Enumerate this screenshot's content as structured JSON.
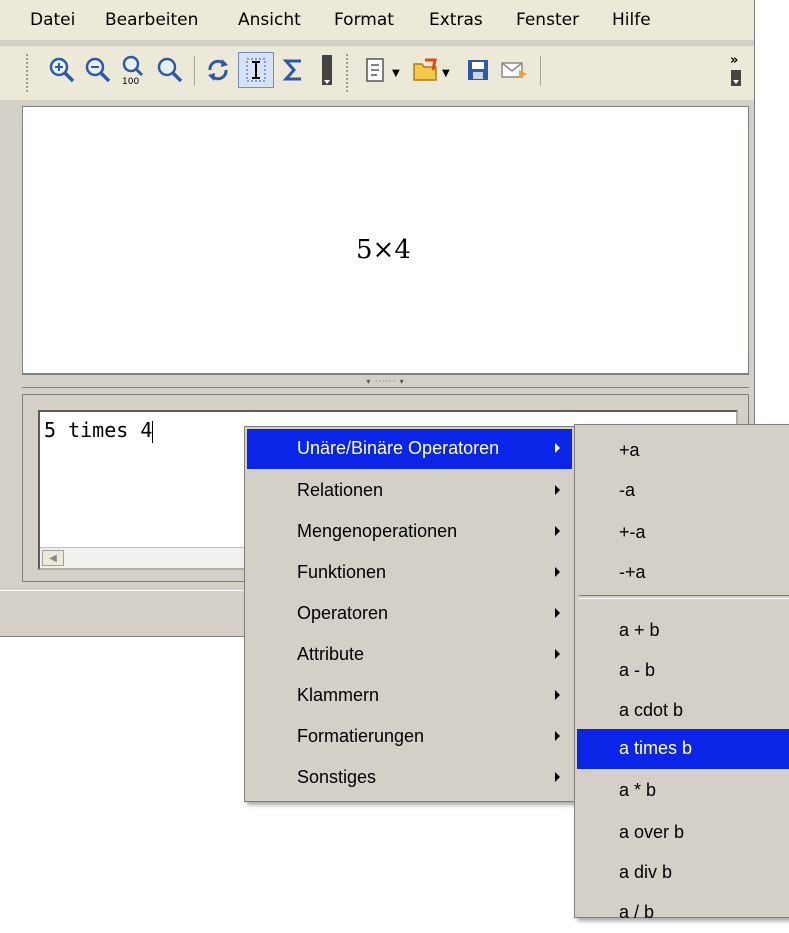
{
  "menubar": {
    "items": [
      "Datei",
      "Bearbeiten",
      "Ansicht",
      "Format",
      "Extras",
      "Fenster",
      "Hilfe"
    ]
  },
  "toolbar": {
    "buttons": [
      "zoom-in-icon",
      "zoom-out-icon",
      "zoom-100-icon",
      "show-all-icon",
      "refresh-icon",
      "formula-cursor-icon",
      "sum-icon",
      "more-icon",
      "import-icon",
      "open-icon",
      "save-icon",
      "send-mail-icon",
      "overflow-icon"
    ],
    "zoom100_label": "100"
  },
  "preview": {
    "formula": "5×4"
  },
  "commands": {
    "text": "5 times 4"
  },
  "context_menu": {
    "items": [
      {
        "label": "Unäre/Binäre Operatoren",
        "highlighted": true
      },
      {
        "label": "Relationen"
      },
      {
        "label": "Mengenoperationen"
      },
      {
        "label": "Funktionen"
      },
      {
        "label": "Operatoren"
      },
      {
        "label": "Attribute"
      },
      {
        "label": "Klammern"
      },
      {
        "label": "Formatierungen"
      },
      {
        "label": "Sonstiges"
      }
    ]
  },
  "submenu": {
    "items": [
      {
        "label": "+a"
      },
      {
        "label": "-a"
      },
      {
        "label": "+-a"
      },
      {
        "label": "-+a"
      },
      {
        "label": "a + b"
      },
      {
        "label": "a - b"
      },
      {
        "label": "a cdot b"
      },
      {
        "label": "a times b",
        "highlighted": true
      },
      {
        "label": "a * b"
      },
      {
        "label": "a over b"
      },
      {
        "label": "a div b"
      },
      {
        "label": "a / b"
      }
    ]
  },
  "colors": {
    "highlight": "#0a24e8",
    "chrome": "#d4d0c8",
    "menubar": "#ece9d8"
  }
}
